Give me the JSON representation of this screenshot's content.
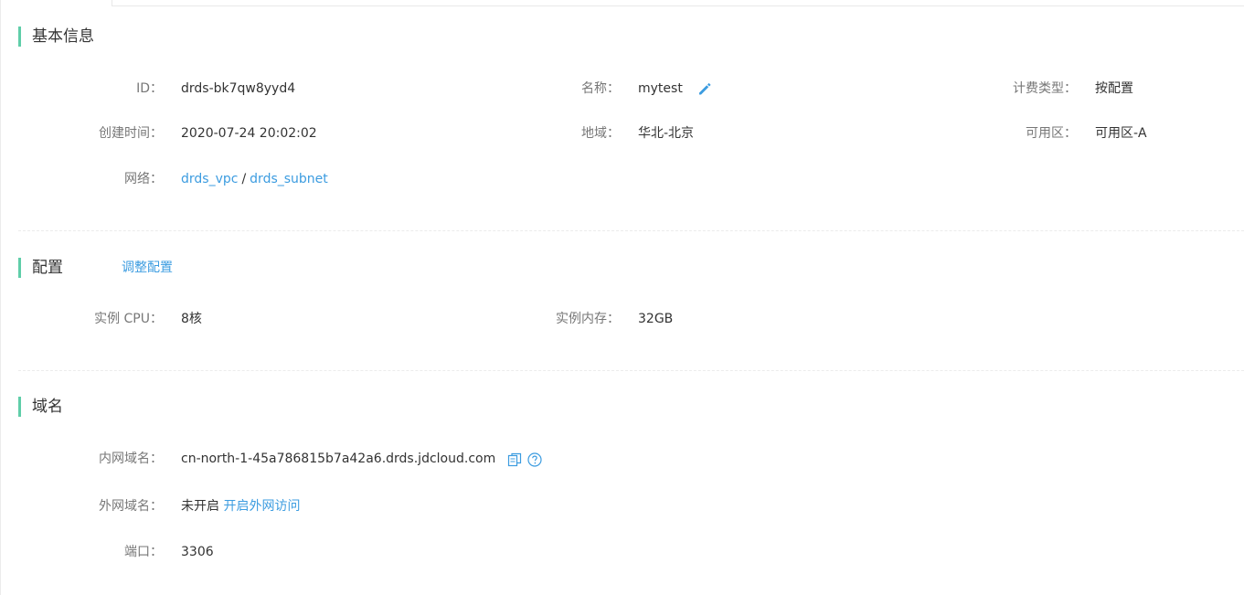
{
  "basic_info": {
    "title": "基本信息",
    "id_label": "ID：",
    "id_value": "drds-bk7qw8yyd4",
    "name_label": "名称：",
    "name_value": "mytest",
    "billing_label": "计费类型：",
    "billing_value": "按配置",
    "created_label": "创建时间：",
    "created_value": "2020-07-24 20:02:02",
    "region_label": "地域：",
    "region_value": "华北-北京",
    "az_label": "可用区：",
    "az_value": "可用区-A",
    "network_label": "网络：",
    "vpc_link": "drds_vpc",
    "network_separator": "/",
    "subnet_link": "drds_subnet"
  },
  "config": {
    "title": "配置",
    "adjust_link": "调整配置",
    "cpu_label": "实例 CPU：",
    "cpu_value": "8核",
    "memory_label": "实例内存：",
    "memory_value": "32GB"
  },
  "domain": {
    "title": "域名",
    "internal_label": "内网域名：",
    "internal_value": "cn-north-1-45a786815b7a42a6.drds.jdcloud.com",
    "external_label": "外网域名：",
    "external_status": "未开启",
    "external_link": "开启外网访问",
    "port_label": "端口：",
    "port_value": "3306"
  },
  "icons": {
    "edit": "pencil-icon",
    "copy": "copy-icon",
    "help": "help-circle-icon"
  },
  "colors": {
    "accent": "#5fcea9",
    "link": "#3c9ce0",
    "label": "#777777",
    "value": "#333333"
  }
}
